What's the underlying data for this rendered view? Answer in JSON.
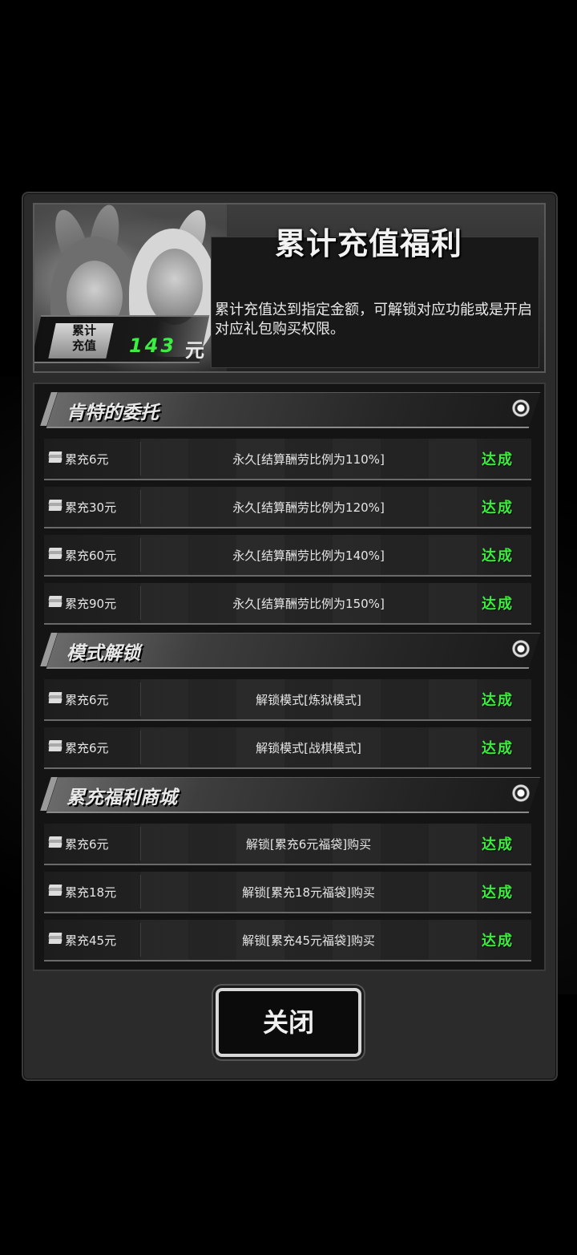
{
  "header": {
    "title": "累计充值福利",
    "description": "累计充值达到指定金额，可解锁对应功能或是开启对应礼包购买权限。",
    "total_label": "累计\n充值",
    "total_value": "143",
    "total_unit": "元"
  },
  "sections": [
    {
      "title": "肯特的委托",
      "rows": [
        {
          "requirement": "累充6元",
          "reward": "永久[结算酬劳比例为110%]",
          "status": "达成"
        },
        {
          "requirement": "累充30元",
          "reward": "永久[结算酬劳比例为120%]",
          "status": "达成"
        },
        {
          "requirement": "累充60元",
          "reward": "永久[结算酬劳比例为140%]",
          "status": "达成"
        },
        {
          "requirement": "累充90元",
          "reward": "永久[结算酬劳比例为150%]",
          "status": "达成"
        }
      ]
    },
    {
      "title": "模式解锁",
      "rows": [
        {
          "requirement": "累充6元",
          "reward": "解锁模式[炼狱模式]",
          "status": "达成"
        },
        {
          "requirement": "累充6元",
          "reward": "解锁模式[战棋模式]",
          "status": "达成"
        }
      ]
    },
    {
      "title": "累充福利商城",
      "rows": [
        {
          "requirement": "累充6元",
          "reward": "解锁[累充6元福袋]购买",
          "status": "达成"
        },
        {
          "requirement": "累充18元",
          "reward": "解锁[累充18元福袋]购买",
          "status": "达成"
        },
        {
          "requirement": "累充45元",
          "reward": "解锁[累充45元福袋]购买",
          "status": "达成"
        }
      ]
    }
  ],
  "footer": {
    "close_label": "关闭"
  },
  "colors": {
    "achieved": "#38f03c",
    "total_value": "#3cf043"
  }
}
